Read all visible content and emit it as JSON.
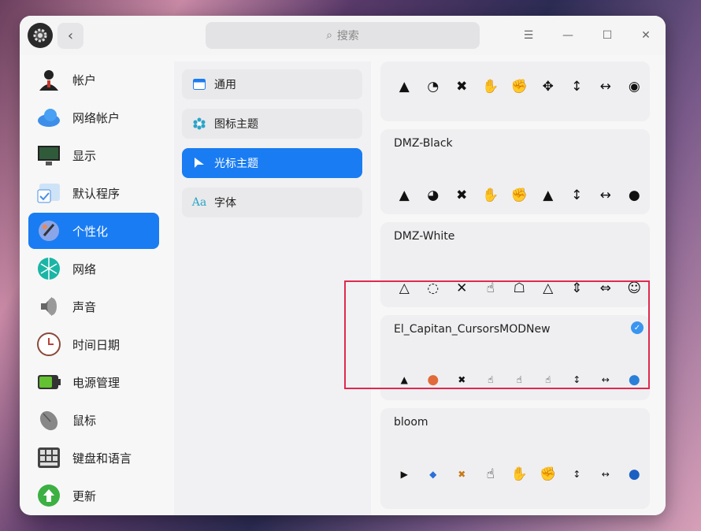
{
  "window": {
    "search_placeholder": "搜索"
  },
  "titlebar": {
    "menu_icon": "☰",
    "minimize_icon": "—",
    "maximize_icon": "☐",
    "close_icon": "✕"
  },
  "sidebar": {
    "items": [
      {
        "label": "帐户",
        "icon": "account-icon",
        "color": "#222222"
      },
      {
        "label": "网络帐户",
        "icon": "cloud-icon",
        "color": "#3d8ee8"
      },
      {
        "label": "显示",
        "icon": "display-icon",
        "color": "#2f5b3a"
      },
      {
        "label": "默认程序",
        "icon": "default-apps-icon",
        "color": "#4a90e2"
      },
      {
        "label": "个性化",
        "icon": "personalization-icon",
        "color": "#6c7ad9",
        "active": true
      },
      {
        "label": "网络",
        "icon": "network-icon",
        "color": "#1bb5a5"
      },
      {
        "label": "声音",
        "icon": "speaker-icon",
        "color": "#555555"
      },
      {
        "label": "时间日期",
        "icon": "clock-icon",
        "color": "#b8433c"
      },
      {
        "label": "电源管理",
        "icon": "battery-icon",
        "color": "#63c132"
      },
      {
        "label": "鼠标",
        "icon": "mouse-icon",
        "color": "#777777"
      },
      {
        "label": "键盘和语言",
        "icon": "keyboard-icon",
        "color": "#444444"
      },
      {
        "label": "更新",
        "icon": "update-icon",
        "color": "#3cb043"
      }
    ]
  },
  "personalization": {
    "items": [
      {
        "label": "通用",
        "icon": "window-icon"
      },
      {
        "label": "图标主题",
        "icon": "flower-icon"
      },
      {
        "label": "光标主题",
        "icon": "cursor-icon",
        "active": true
      },
      {
        "label": "字体",
        "icon": "font-icon"
      }
    ]
  },
  "cursor_themes": [
    {
      "name": "",
      "cursors": [
        "▲",
        "◔",
        "✖",
        "✋",
        "✊",
        "✥",
        "↕",
        "↔",
        "◉"
      ]
    },
    {
      "name": "DMZ-Black",
      "cursors": [
        "▲",
        "◕",
        "✖",
        "✋",
        "✊",
        "▲",
        "↕",
        "↔",
        "●"
      ]
    },
    {
      "name": "DMZ-White",
      "cursors": [
        "△",
        "◌",
        "✕",
        "☝",
        "☖",
        "△",
        "⇕",
        "⇔",
        "☺"
      ]
    },
    {
      "name": "El_Capitan_CursorsMODNew",
      "selected": true,
      "cursors": [
        "▲",
        "●",
        "✖",
        "☝",
        "☝",
        "☝",
        "↕",
        "↔",
        "●"
      ]
    },
    {
      "name": "bloom",
      "cursors": [
        "▶",
        "◆",
        "✖",
        "☝",
        "✋",
        "✊",
        "↕",
        "↔",
        "●"
      ]
    }
  ]
}
